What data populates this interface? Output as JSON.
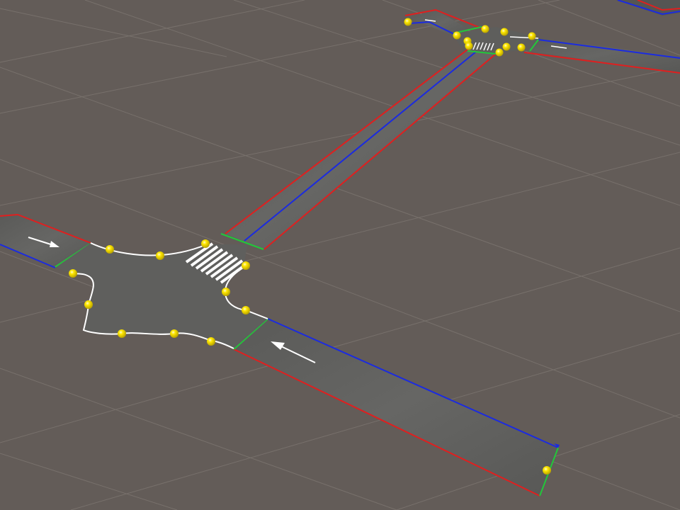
{
  "scene_view": {
    "colors": {
      "background": "#635c58",
      "grid": "#7c7570",
      "asphalt": "#555553",
      "asphalt_light": "#6c6c6a",
      "curb_line": "#ffffff",
      "marking": "#ffffff",
      "edge_left": "#e01f1f",
      "edge_right": "#1b2be0",
      "lane_end": "#22c73a",
      "control_point": "#f2e000"
    },
    "gizmos": {
      "road_edges": [
        "red-boundary",
        "blue-boundary",
        "green-lane-end"
      ],
      "control_point_icon": "yellow-sphere",
      "lane_arrow_icon": "arrow-icon",
      "crosswalk": "zebra-crossing"
    }
  }
}
